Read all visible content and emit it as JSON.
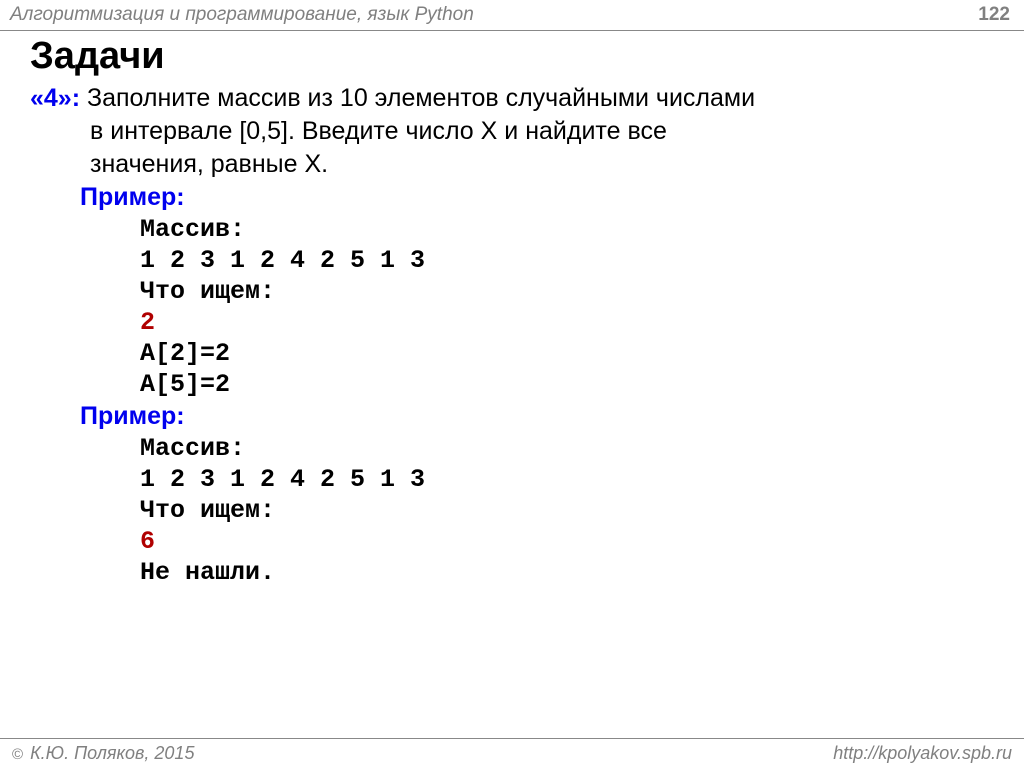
{
  "header": {
    "title": "Алгоритмизация и программирование, язык Python",
    "page": "122"
  },
  "title": "Задачи",
  "grade": "«4»:",
  "task_l1": " Заполните массив из 10 элементов случайными числами",
  "task_l2": "в интервале [0,5]. Введите число X и найдите все",
  "task_l3": "значения, равные X.",
  "example_label": "Пример:",
  "ex1": {
    "l1": "Массив:",
    "l2": "1 2 3 1 2 4 2 5 1 3",
    "l3": "Что ищем:",
    "l4": "2",
    "l5": "A[2]=2",
    "l6": "A[5]=2"
  },
  "ex2": {
    "l1": "Массив:",
    "l2": "1 2 3 1 2 4 2 5 1 3",
    "l3": "Что ищем:",
    "l4": "6",
    "l5": "Не нашли."
  },
  "footer": {
    "copyright": " К.Ю. Поляков, 2015",
    "url": "http://kpolyakov.spb.ru"
  }
}
